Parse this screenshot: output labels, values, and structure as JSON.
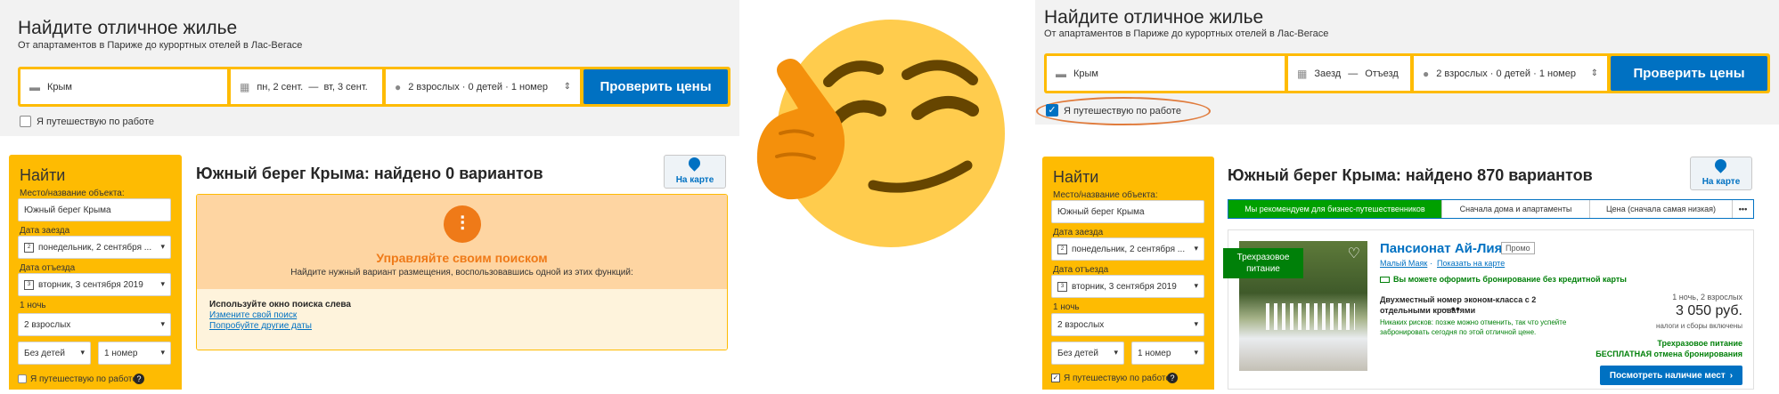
{
  "left": {
    "hero": {
      "title": "Найдите отличное жилье",
      "subtitle": "От апартаментов в Париже до курортных отелей в Лас-Вегасе"
    },
    "search": {
      "destination": "Крым",
      "dates": "пн, 2 сент.  —  вт, 3 сент.",
      "guests": "2 взрослых · 0 детей · 1 номер",
      "button": "Проверить цены",
      "business_label": "Я путешествую по работе"
    },
    "sidebar": {
      "title": "Найти",
      "place_label": "Место/название объекта:",
      "place_value": "Южный берег Крыма",
      "checkin_label": "Дата заезда",
      "checkin_value": "понедельник, 2 сентября ...",
      "checkout_label": "Дата отъезда",
      "checkout_value": "вторник, 3 сентября 2019",
      "nights": "1 ночь",
      "adults": "2 взрослых",
      "children": "Без детей",
      "rooms": "1 номер",
      "business_label": "Я путешествую по работе"
    },
    "results": {
      "title": "Южный берег Крыма: найдено 0 вариантов",
      "map_label": "На карте",
      "empty_heading": "Управляйте своим поиском",
      "empty_sub": "Найдите нужный вариант размещения, воспользовавшись одной из этих функций:",
      "tips_title": "Используйте окно поиска слева",
      "tip_1": "Измените свой поиск",
      "tip_2": "Попробуйте другие даты"
    }
  },
  "right": {
    "hero": {
      "title": "Найдите отличное жилье",
      "subtitle": "От апартаментов в Париже до курортных отелей в Лас-Вегасе"
    },
    "search": {
      "destination": "Крым",
      "checkin": "Заезд",
      "dash": "—",
      "checkout": "Отъезд",
      "guests": "2 взрослых · 0 детей · 1 номер",
      "button": "Проверить цены",
      "business_label": "Я путешествую по работе"
    },
    "sidebar": {
      "title": "Найти",
      "place_label": "Место/название объекта:",
      "place_value": "Южный берег Крыма",
      "checkin_label": "Дата заезда",
      "checkin_value": "понедельник, 2 сентября ...",
      "checkout_label": "Дата отъезда",
      "checkout_value": "вторник, 3 сентября 2019",
      "nights": "1 ночь",
      "adults": "2 взрослых",
      "children": "Без детей",
      "rooms": "1 номер",
      "business_label": "Я путешествую по работе"
    },
    "results": {
      "title": "Южный берег Крыма: найдено 870 вариантов",
      "map_label": "На карте",
      "tabs": [
        "Мы рекомендуем для бизнес-путешественников",
        "Сначала дома и апартаменты",
        "Цена (сначала самая низкая)"
      ],
      "more": "•••"
    },
    "card": {
      "ribbon": "Трехразовое питание",
      "name": "Пансионат Ай-Лия",
      "badge": "Промо",
      "location": "Малый Маяк",
      "map_link": "Показать на карте",
      "no_card": "Вы можете оформить бронирование без кредитной карты",
      "room": "Двухместный номер эконом-класса с 2 отдельными кроватями",
      "no_risk": "Никаких рисков: позже можно отменить, так что успейте забронировать сегодня по этой отличной цене.",
      "stay": "1 ночь, 2 взрослых",
      "price": "3 050 руб.",
      "taxes": "налоги и сборы включены",
      "meals": "Трехразовое питание",
      "free_cancel": "БЕСПЛАТНАЯ отмена бронирования",
      "cta": "Посмотреть наличие мест"
    }
  },
  "colors": {
    "booking_yellow": "#febb02",
    "booking_blue": "#0071c2",
    "highlight_orange": "#e07b3c",
    "emoji_yellow": "#ffcc4d"
  }
}
